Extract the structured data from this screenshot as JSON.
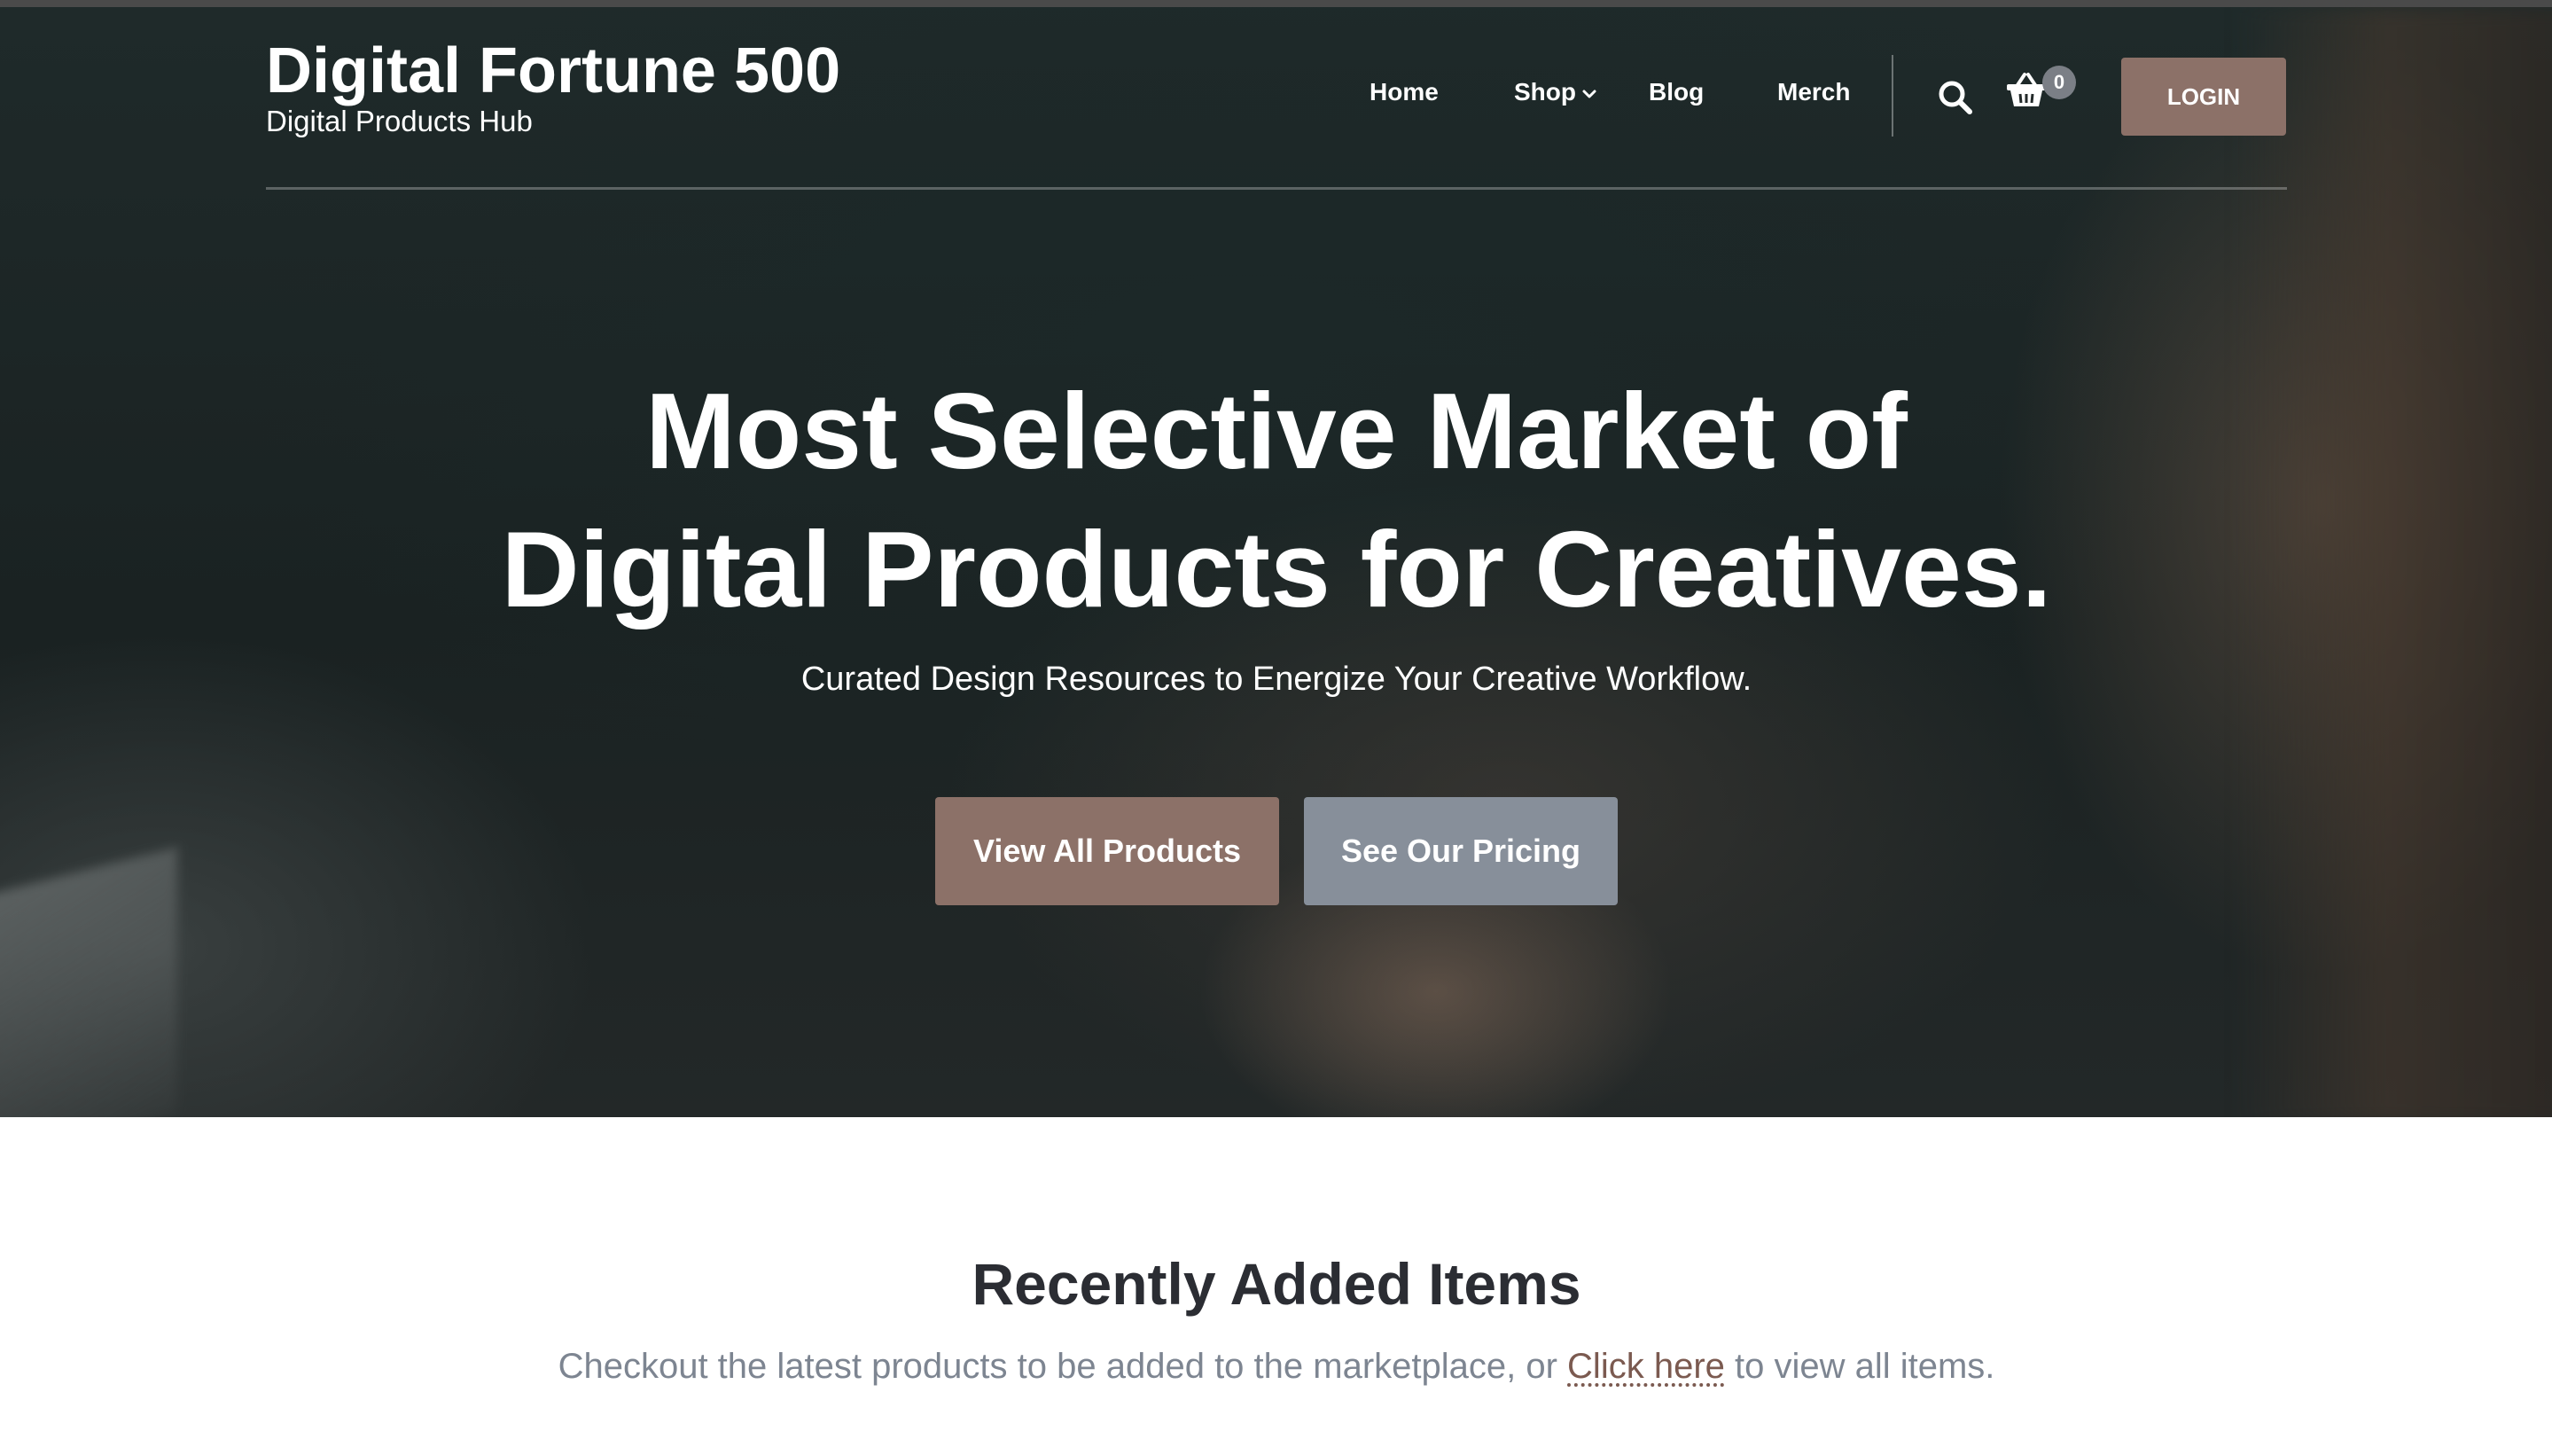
{
  "header": {
    "site_title": "Digital Fortune 500",
    "tagline": "Digital Products Hub",
    "nav": {
      "home": "Home",
      "shop": "Shop",
      "blog": "Blog",
      "merch": "Merch"
    },
    "cart_count": "0",
    "login_label": "LOGIN",
    "icons": {
      "search": "search-icon",
      "cart": "basket-icon",
      "dropdown": "chevron-down-icon"
    }
  },
  "hero": {
    "title_line1": "Most Selective Market of",
    "title_line2": "Digital Products for Creatives.",
    "subtitle": "Curated Design Resources to Energize Your Creative Workflow.",
    "primary_button": "View All Products",
    "secondary_button": "See Our Pricing"
  },
  "recent": {
    "title": "Recently Added Items",
    "desc_before": "Checkout the latest products to be added to the marketplace, or ",
    "link_text": "Click here",
    "desc_after": " to view all items."
  },
  "colors": {
    "accent_brown": "#8c7168",
    "accent_gray": "#878f9a",
    "link": "#7b5a50",
    "heading_dark": "#2b2d33",
    "muted_text": "#7d8591"
  }
}
